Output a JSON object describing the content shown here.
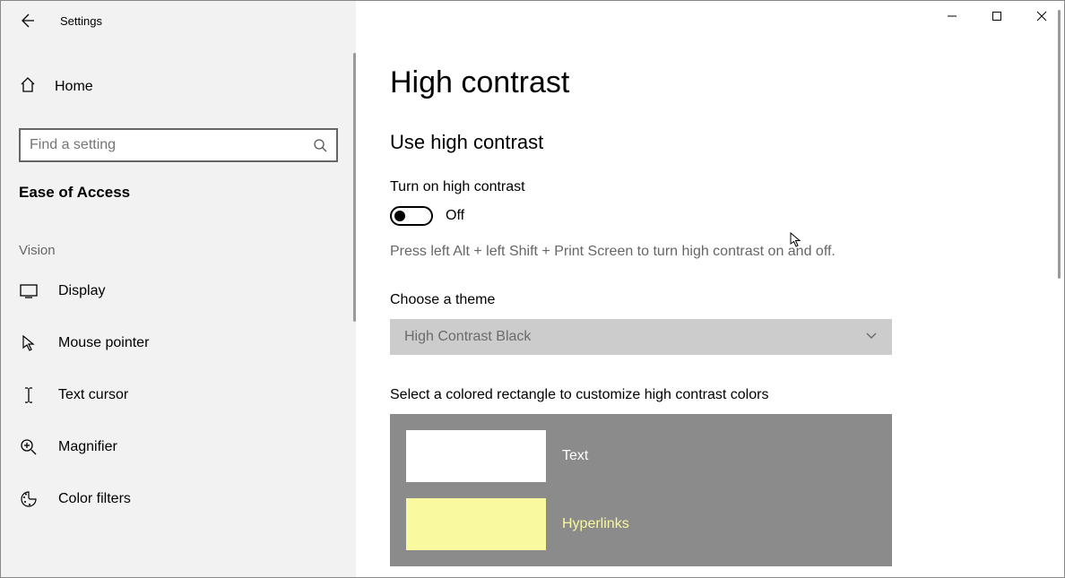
{
  "app_title": "Settings",
  "sidebar": {
    "home_label": "Home",
    "search_placeholder": "Find a setting",
    "category": "Ease of Access",
    "section": "Vision",
    "items": [
      {
        "name": "display",
        "label": "Display"
      },
      {
        "name": "mouse-pointer",
        "label": "Mouse pointer"
      },
      {
        "name": "text-cursor",
        "label": "Text cursor"
      },
      {
        "name": "magnifier",
        "label": "Magnifier"
      },
      {
        "name": "color-filters",
        "label": "Color filters"
      }
    ]
  },
  "main": {
    "page_title": "High contrast",
    "section_title": "Use high contrast",
    "toggle_label": "Turn on high contrast",
    "toggle_state": "Off",
    "hint": "Press left Alt + left Shift + Print Screen to turn high contrast on and off.",
    "theme_label": "Choose a theme",
    "theme_value": "High Contrast Black",
    "swatch_heading": "Select a colored rectangle to customize high contrast colors",
    "swatches": [
      {
        "label": "Text",
        "fill": "#ffffff",
        "label_color": "#ffffff"
      },
      {
        "label": "Hyperlinks",
        "fill": "#f9f99f",
        "label_color": "#f9f99f"
      }
    ]
  }
}
